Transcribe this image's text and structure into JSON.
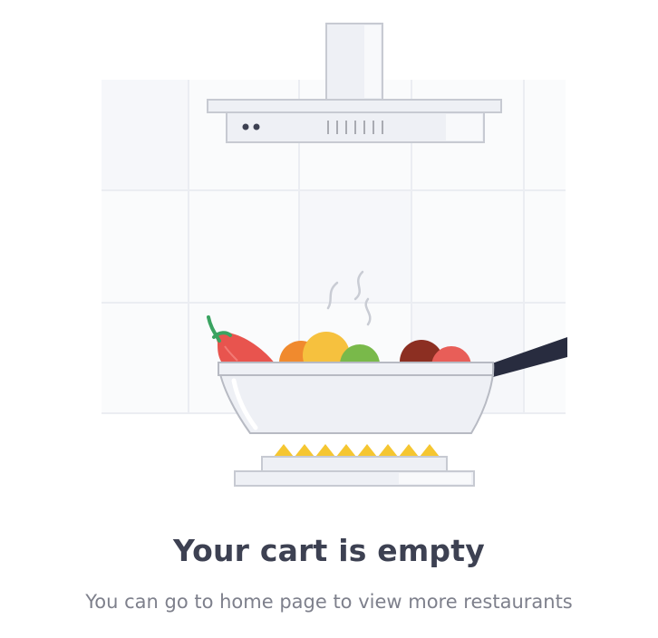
{
  "empty_state": {
    "title": "Your cart is empty",
    "subtitle": "You can go to home page to view more restaurants"
  },
  "illustration": {
    "subject": "cooking-pan-on-stove",
    "colors": {
      "tile_line": "#ebedf2",
      "tile_fill": "#f8f9fb",
      "steel": "#eef0f5",
      "outline": "#c7cad2",
      "handle": "#282c3f",
      "flame": "#f5c631",
      "pepper": "#e8544e",
      "stem": "#3aa361",
      "orange": "#f08a2e",
      "lemon": "#f6c13e",
      "lime": "#79b94a",
      "onion": "#8c2f22",
      "tomato": "#e85e58"
    }
  }
}
